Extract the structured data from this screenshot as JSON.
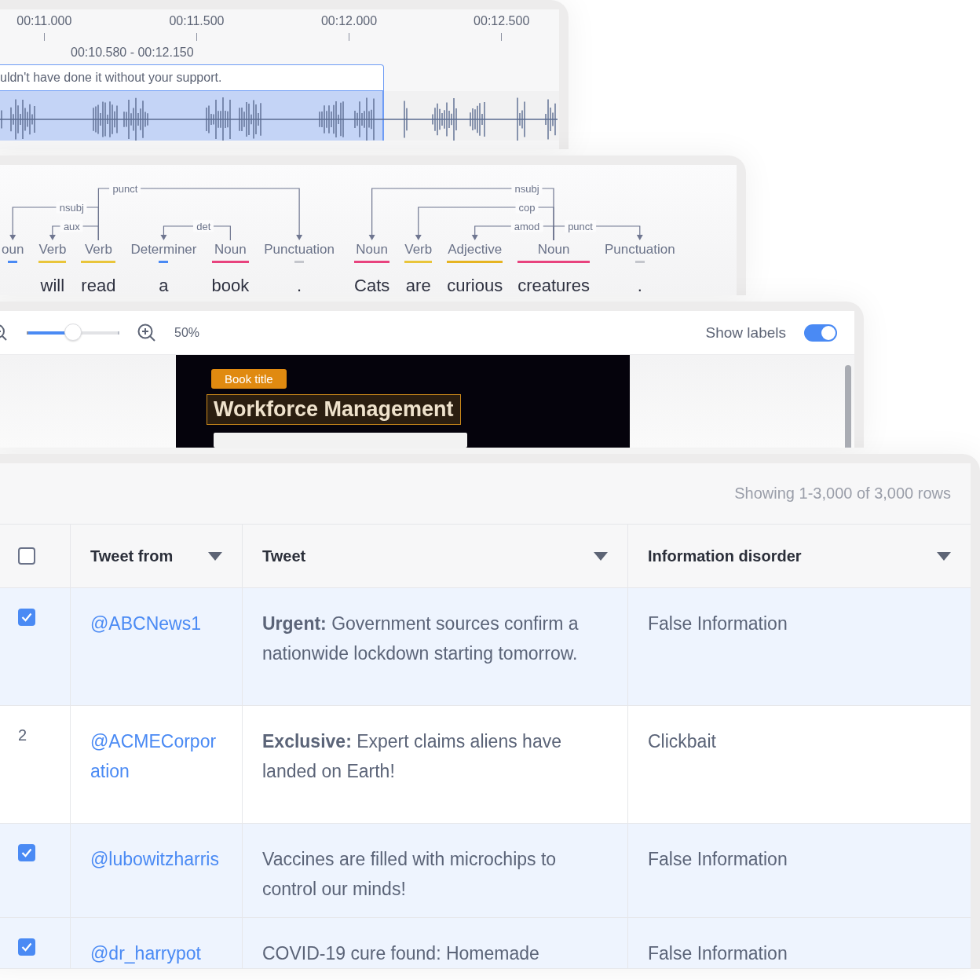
{
  "audio": {
    "ticks": [
      "00:11.000",
      "00:11.500",
      "00:12.000",
      "00:12.500"
    ],
    "range": "00:10.580 - 00:12.150",
    "segment": {
      "text": "uldn't have done it without your support.",
      "selected": true
    }
  },
  "dependency": {
    "sentences": [
      {
        "tokens": [
          {
            "tag": "oun",
            "color": "#4a8af4"
          },
          {
            "tag": "Verb",
            "word": "will",
            "color": "#e9c53b"
          },
          {
            "tag": "Verb",
            "word": "read",
            "color": "#e9c53b"
          },
          {
            "tag": "Determiner",
            "word": "a",
            "color": "#4a8af4"
          },
          {
            "tag": "Noun",
            "word": "book",
            "color": "#e8437e"
          },
          {
            "tag": "Punctuation",
            "word": ".",
            "color": "#c4c6cc"
          }
        ],
        "arcs": [
          {
            "label": "punct"
          },
          {
            "label": "nsubj"
          },
          {
            "label": "aux"
          },
          {
            "label": "det"
          }
        ]
      },
      {
        "tokens": [
          {
            "tag": "Noun",
            "word": "Cats",
            "color": "#e8437e"
          },
          {
            "tag": "Verb",
            "word": "are",
            "color": "#e9c53b"
          },
          {
            "tag": "Adjective",
            "word": "curious",
            "color": "#e6b422"
          },
          {
            "tag": "Noun",
            "word": "creatures",
            "color": "#e8437e"
          },
          {
            "tag": "Punctuation",
            "word": ".",
            "color": "#c4c6cc"
          }
        ],
        "arcs": [
          {
            "label": "nsubj"
          },
          {
            "label": "cop"
          },
          {
            "label": "amod"
          },
          {
            "label": "punct"
          }
        ]
      }
    ]
  },
  "viewer": {
    "zoom": {
      "level": 0.5,
      "reading": "50%"
    },
    "show_labels": {
      "label": "Show labels",
      "on": true
    },
    "annotation": {
      "label": "Book title",
      "text": "Workforce Management"
    }
  },
  "table": {
    "summary": "Showing 1-3,000 of 3,000 rows",
    "select_all": {
      "checked": false
    },
    "columns": [
      {
        "label": "Tweet from"
      },
      {
        "label": "Tweet"
      },
      {
        "label": "Information disorder"
      }
    ],
    "rows": [
      {
        "checked": true,
        "user": "@ABCNews1",
        "tweet": "**Urgent:** Government sources confirm a nationwide lockdown starting tomorrow.",
        "category": "False Information"
      },
      {
        "checked": false,
        "number": "2",
        "user": "@ACMECorporation",
        "tweet": "**Exclusive:** Expert claims aliens have landed on Earth!",
        "category": "Clickbait"
      },
      {
        "checked": true,
        "user": "@lubowitzharris",
        "tweet": "Vaccines are filled with microchips to control our minds!",
        "category": "False Information"
      },
      {
        "checked": true,
        "user": "@dr_harrypot",
        "tweet": "COVID-19 cure found: Homemade",
        "category": "False Information"
      }
    ]
  }
}
